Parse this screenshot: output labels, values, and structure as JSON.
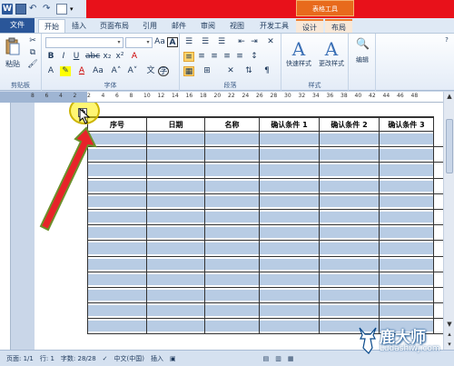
{
  "titlebar": {
    "context_tools": "表格工具"
  },
  "tabs": [
    {
      "label": "文件",
      "kind": "file"
    },
    {
      "label": "开始",
      "kind": "active"
    },
    {
      "label": "插入"
    },
    {
      "label": "页面布局"
    },
    {
      "label": "引用"
    },
    {
      "label": "邮件"
    },
    {
      "label": "审阅"
    },
    {
      "label": "视图"
    },
    {
      "label": "开发工具"
    },
    {
      "label": "设计",
      "kind": "ctx"
    },
    {
      "label": "布局",
      "kind": "ctx"
    }
  ],
  "ribbon": {
    "clipboard": {
      "label": "剪贴板",
      "paste": "粘贴"
    },
    "font": {
      "label": "字体"
    },
    "paragraph": {
      "label": "段落"
    },
    "styles": {
      "label": "样式",
      "quick_styles": "快速样式",
      "change_styles": "更改样式"
    },
    "editing": {
      "label": "编辑"
    }
  },
  "ruler": {
    "ticks": [
      "8",
      "6",
      "4",
      "2",
      "2",
      "4",
      "6",
      "8",
      "10",
      "12",
      "14",
      "16",
      "18",
      "20",
      "22",
      "24",
      "26",
      "28",
      "30",
      "32",
      "34",
      "36",
      "38",
      "40",
      "42",
      "44",
      "46",
      "48"
    ]
  },
  "table": {
    "headers": [
      "序号",
      "日期",
      "名称",
      "确认条件 1",
      "确认条件 2",
      "确认条件 3"
    ],
    "row_count": 13
  },
  "statusbar": {
    "page": "页面: 1/1",
    "line": "行: 1",
    "words": "字数: 28/28",
    "language": "中文(中国)",
    "mode": "插入"
  },
  "watermark": {
    "brand": "鹿大师",
    "url": "Ludashiwj.com"
  },
  "colors": {
    "accent_red": "#e8111a",
    "selection": "#b8cce4",
    "file_tab": "#2a5699"
  }
}
